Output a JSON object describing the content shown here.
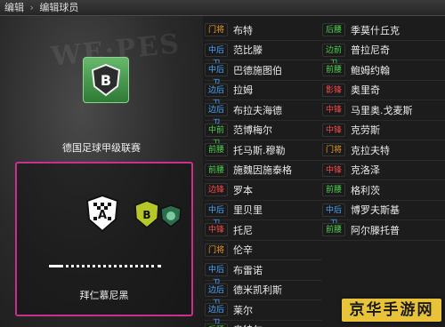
{
  "breadcrumb": [
    "编辑",
    "编辑球员"
  ],
  "league": {
    "name": "德国足球甲级联赛",
    "badge_letter": "B"
  },
  "team": {
    "name": "拜仁慕尼黑",
    "logo_letter": "A",
    "secondary_logo_letter": "B"
  },
  "positions": {
    "GK": "门将",
    "DF_C": "中后卫",
    "DF_S": "边后卫",
    "MF_C": "中前卫",
    "MF_W": "前腰",
    "FW_S": "影锋",
    "FW_C": "中锋"
  },
  "roster_left": [
    {
      "pos": "门将",
      "cls": "gk",
      "name": "布特"
    },
    {
      "pos": "中后卫",
      "cls": "df",
      "name": "范比滕"
    },
    {
      "pos": "中后卫",
      "cls": "df",
      "name": "巴德施图伯"
    },
    {
      "pos": "边后卫",
      "cls": "df",
      "name": "拉姆"
    },
    {
      "pos": "边后卫",
      "cls": "df",
      "name": "布拉夫海德"
    },
    {
      "pos": "中前卫",
      "cls": "mf",
      "name": "范博梅尔"
    },
    {
      "pos": "前腰",
      "cls": "mf",
      "name": "托马斯.穆勒"
    },
    {
      "pos": "前腰",
      "cls": "mf",
      "name": "施魏因施泰格"
    },
    {
      "pos": "边锋",
      "cls": "fw",
      "name": "罗本"
    },
    {
      "pos": "中后卫",
      "cls": "df",
      "name": "里贝里"
    },
    {
      "pos": "中锋",
      "cls": "fw",
      "name": "托尼"
    },
    {
      "pos": "门将",
      "cls": "gk",
      "name": "伦辛"
    },
    {
      "pos": "中后卫",
      "cls": "df",
      "name": "布雷诺"
    },
    {
      "pos": "边后卫",
      "cls": "df",
      "name": "德米凯利斯"
    },
    {
      "pos": "边后卫",
      "cls": "df",
      "name": "莱尔"
    },
    {
      "pos": "后腰",
      "cls": "mf",
      "name": "奥特尔"
    }
  ],
  "roster_right": [
    {
      "pos": "后腰",
      "cls": "mf",
      "name": "季莫什丘克"
    },
    {
      "pos": "边前卫",
      "cls": "mf",
      "name": "普拉尼奇"
    },
    {
      "pos": "前腰",
      "cls": "mf",
      "name": "鲍姆约翰"
    },
    {
      "pos": "影锋",
      "cls": "fw",
      "name": "奥里奇"
    },
    {
      "pos": "中锋",
      "cls": "fw",
      "name": "马里奥.戈麦斯"
    },
    {
      "pos": "中锋",
      "cls": "fw",
      "name": "克劳斯"
    },
    {
      "pos": "门将",
      "cls": "gk",
      "name": "克拉夫特"
    },
    {
      "pos": "中锋",
      "cls": "fw",
      "name": "克洛泽"
    },
    {
      "pos": "前腰",
      "cls": "mf",
      "name": "格利茨"
    },
    {
      "pos": "中后卫",
      "cls": "df",
      "name": "博罗夫斯基"
    },
    {
      "pos": "前腰",
      "cls": "mf",
      "name": "阿尔滕托普"
    }
  ],
  "watermark": "京华手游网",
  "colors": {
    "highlight_border": "#c8318a",
    "badge_green": "#3f9a46",
    "watermark_bg": "#e8c33a"
  },
  "load_progress": 0.12
}
